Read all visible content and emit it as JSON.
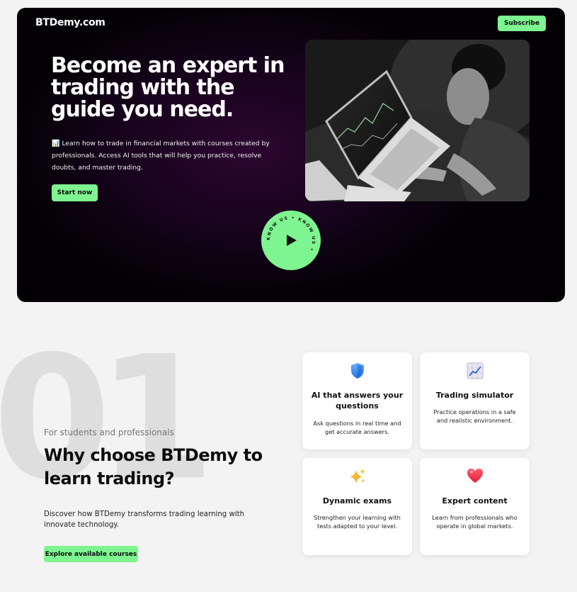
{
  "header": {
    "logo": "BTDemy.com",
    "subscribe_label": "Subscribe"
  },
  "hero": {
    "title": "Become an expert in trading with the guide you need.",
    "description": "📊 Learn how to trade in financial markets with courses created by professionals. Access AI tools that will help you practice, resolve doubts, and master trading.",
    "cta_label": "Start now",
    "badge_text": "KNOW US • KNOW US • ",
    "photo_icon": "laptop-trading-photo",
    "play_icon": "play-icon"
  },
  "section": {
    "number": "01",
    "eyebrow": "For students and professionals",
    "title": "Why choose BTDemy to learn trading?",
    "description": "Discover how BTDemy transforms trading learning with innovate technology.",
    "cta_label": "Explore available courses"
  },
  "features": [
    {
      "icon": "shield-icon",
      "title": "AI that answers your questions",
      "description": "Ask questions in real time and get accurate answers."
    },
    {
      "icon": "chart-up-icon",
      "title": "Trading simulator",
      "description": "Practice operations in a safe and realistic environment."
    },
    {
      "icon": "sparkles-icon",
      "title": "Dynamic exams",
      "description": "Strengthen your learning with tests adapted to your level."
    },
    {
      "icon": "heart-icon",
      "title": "Expert content",
      "description": "Learn from professionals who operate in global markets."
    }
  ],
  "colors": {
    "accent": "#7ef590",
    "hero_bg": "#000000",
    "hero_glow": "#2c0630",
    "page_bg": "#f3f3f3"
  }
}
